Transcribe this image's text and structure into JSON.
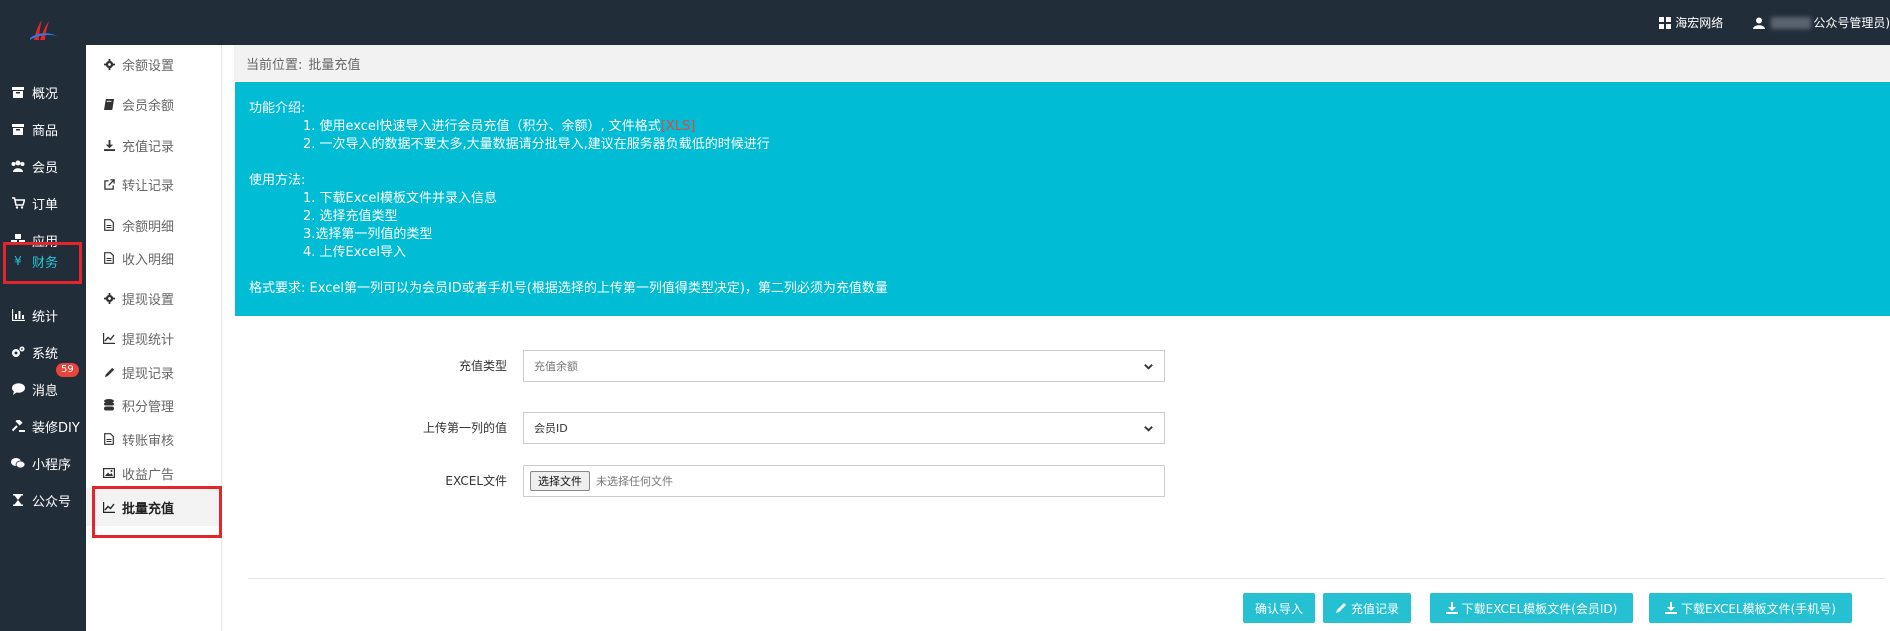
{
  "topbar": {
    "brand_item": "海宏网络",
    "user_item": "公众号管理员)"
  },
  "leftnav": [
    {
      "label": "概况",
      "icon": "archive-icon"
    },
    {
      "label": "商品",
      "icon": "archive-icon"
    },
    {
      "label": "会员",
      "icon": "users-icon"
    },
    {
      "label": "订单",
      "icon": "cart-icon"
    },
    {
      "label": "应用",
      "icon": "cubes-icon"
    },
    {
      "label": "财务",
      "icon": "yen-icon",
      "active": true
    },
    {
      "label": "统计",
      "icon": "bar-chart-icon"
    },
    {
      "label": "系统",
      "icon": "gears-icon"
    },
    {
      "label": "消息",
      "icon": "comment-icon",
      "badge": "59"
    },
    {
      "label": "装修DIY",
      "icon": "gavel-icon"
    },
    {
      "label": "小程序",
      "icon": "wechat-icon"
    },
    {
      "label": "公众号",
      "icon": "hourglass-icon"
    }
  ],
  "subnav": [
    {
      "label": "余额设置",
      "icon": "gear-icon"
    },
    {
      "label": "会员余额",
      "icon": "book-icon"
    },
    {
      "label": "充值记录",
      "icon": "download-icon"
    },
    {
      "label": "转让记录",
      "icon": "external-link-icon"
    },
    {
      "label": "余额明细",
      "icon": "file-icon"
    },
    {
      "label": "收入明细",
      "icon": "file-icon"
    },
    {
      "label": "提现设置",
      "icon": "gear-icon"
    },
    {
      "label": "提现统计",
      "icon": "line-chart-icon"
    },
    {
      "label": "提现记录",
      "icon": "pencil-icon"
    },
    {
      "label": "积分管理",
      "icon": "database-icon"
    },
    {
      "label": "转账审核",
      "icon": "file-icon"
    },
    {
      "label": "收益广告",
      "icon": "image-icon"
    },
    {
      "label": "批量充值",
      "icon": "line-chart-icon",
      "active": true
    }
  ],
  "breadcrumb": {
    "prefix": "当前位置:",
    "current": "批量充值"
  },
  "info": {
    "intro_title": "功能介绍:",
    "intro_1_pre": "1. 使用excel快速导入进行会员充值（积分、余额）, 文件格式",
    "intro_1_format": "[XLS]",
    "intro_2": "2. 一次导入的数据不要太多,大量数据请分批导入,建议在服务器负载低的时候进行",
    "usage_title": "使用方法:",
    "usage_1": "1. 下载Excel模板文件并录入信息",
    "usage_2": "2. 选择充值类型",
    "usage_3": "3.选择第一列值的类型",
    "usage_4": "4. 上传Excel导入",
    "format_req": "格式要求:   Excel第一列可以为会员ID或者手机号(根据选择的上传第一列值得类型决定)，第二列必须为充值数量"
  },
  "form": {
    "type_label": "充值类型",
    "type_value": "充值余额",
    "first_col_label": "上传第一列的值",
    "first_col_value": "会员ID",
    "file_label": "EXCEL文件",
    "file_button": "选择文件",
    "file_status": "未选择任何文件"
  },
  "actions": {
    "confirm": "确认导入",
    "records": "充值记录",
    "download_id": "下载EXCEL模板文件(会员ID)",
    "download_mobile": "下载EXCEL模板文件(手机号)"
  },
  "colors": {
    "topbar_bg": "#222d3a",
    "accent": "#00bcd4",
    "button": "#26c0d3",
    "highlight_border": "#e2262c",
    "badge": "#e8443c"
  }
}
